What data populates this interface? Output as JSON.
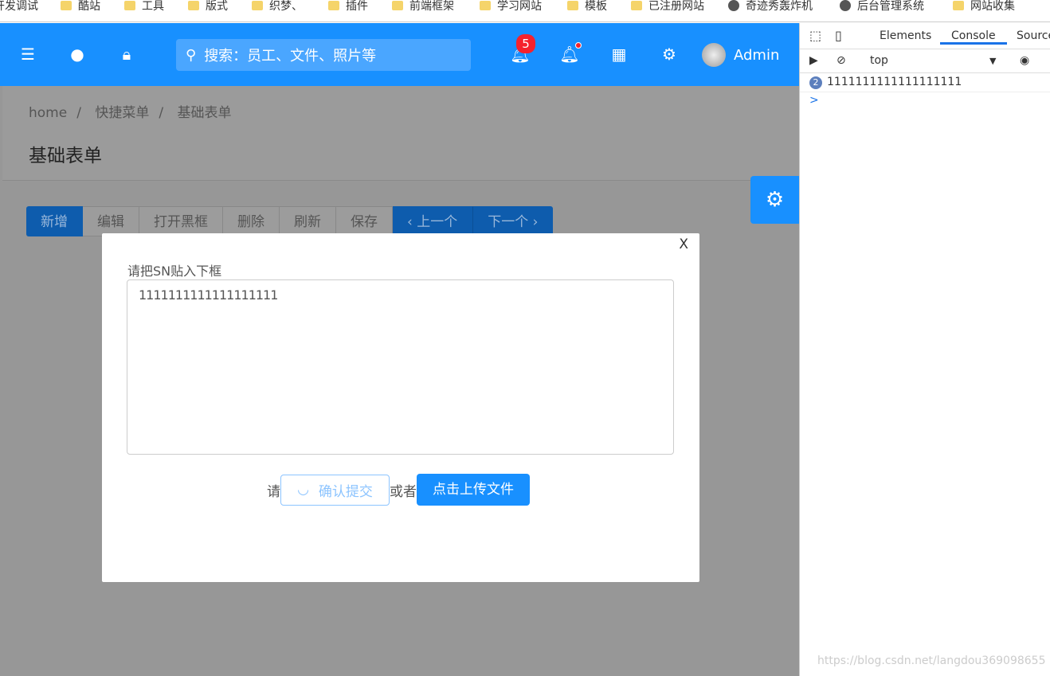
{
  "bookmarks": [
    "开发调试",
    "酷站",
    "工具",
    "版式",
    "织梦、",
    "插件",
    "前端框架",
    "学习网站",
    "模板",
    "已注册网站",
    "奇迹秀轰炸机",
    "后台管理系统",
    "网站收集"
  ],
  "header": {
    "search_placeholder": "搜索：员工、文件、照片等",
    "notification_count": "5",
    "user": "Admin",
    "accent": "#1890ff"
  },
  "breadcrumb": [
    "home",
    "快捷菜单",
    "基础表单"
  ],
  "page_title": "基础表单",
  "toolbar": {
    "add": "新增",
    "edit": "编辑",
    "open_black": "打开黑框",
    "delete": "删除",
    "refresh": "刷新",
    "save": "保存",
    "prev": "上一个",
    "next": "下一个"
  },
  "dialog": {
    "close": "X",
    "label": "请把SN贴入下框",
    "textarea_value": "1111111111111111111",
    "please": "请",
    "confirm": "确认提交",
    "or": "或者",
    "upload": "点击上传文件"
  },
  "devtools": {
    "tabs": [
      "Elements",
      "Console",
      "Sources"
    ],
    "context": "top",
    "log_count": "2",
    "log_text": "1111111111111111111",
    "prompt": ">"
  },
  "watermark": "https://blog.csdn.net/langdou369098655"
}
